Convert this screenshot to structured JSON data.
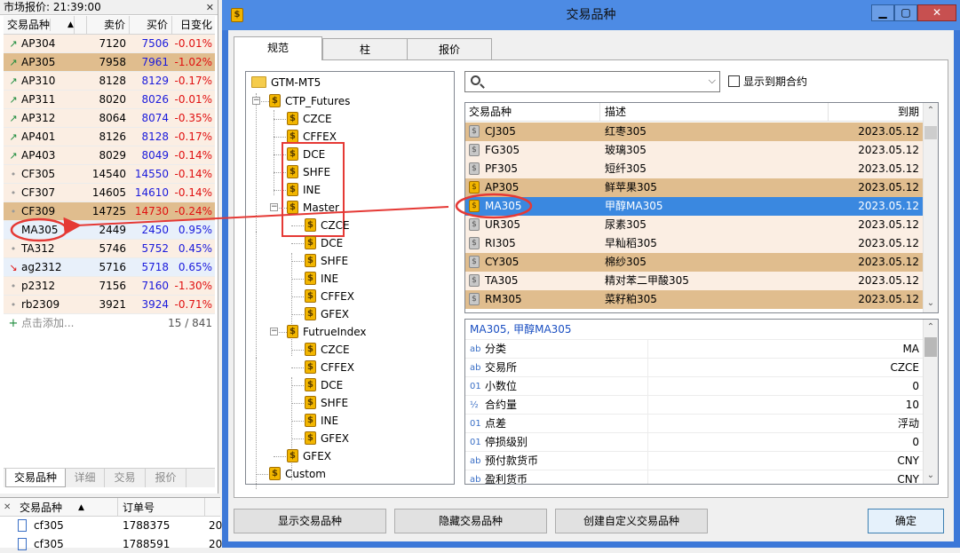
{
  "market": {
    "title": "市场报价: 21:39:00",
    "close": "✕",
    "columns": [
      "交易品种",
      "卖价",
      "买价",
      "日变化"
    ],
    "rows": [
      {
        "icon": "↗",
        "icon_color": "#1b8a3a",
        "symbol": "AP304",
        "bid": "7120",
        "ask": "7506",
        "change": "-0.01%",
        "style": "peach"
      },
      {
        "icon": "↗",
        "icon_color": "#1b8a3a",
        "symbol": "AP305",
        "bid": "7958",
        "ask": "7961",
        "change": "-1.02%",
        "style": "hl"
      },
      {
        "icon": "↗",
        "icon_color": "#1b8a3a",
        "symbol": "AP310",
        "bid": "8128",
        "ask": "8129",
        "change": "-0.17%",
        "style": "peach"
      },
      {
        "icon": "↗",
        "icon_color": "#1b8a3a",
        "symbol": "AP311",
        "bid": "8020",
        "ask": "8026",
        "change": "-0.01%",
        "style": "peach"
      },
      {
        "icon": "↗",
        "icon_color": "#1b8a3a",
        "symbol": "AP312",
        "bid": "8064",
        "ask": "8074",
        "change": "-0.35%",
        "style": "peach"
      },
      {
        "icon": "↗",
        "icon_color": "#1b8a3a",
        "symbol": "AP401",
        "bid": "8126",
        "ask": "8128",
        "change": "-0.17%",
        "style": "peach"
      },
      {
        "icon": "↗",
        "icon_color": "#1b8a3a",
        "symbol": "AP403",
        "bid": "8029",
        "ask": "8049",
        "change": "-0.14%",
        "style": "peach"
      },
      {
        "icon": "•",
        "icon_color": "#999999",
        "symbol": "CF305",
        "bid": "14540",
        "ask": "14550",
        "change": "-0.14%",
        "style": "peach"
      },
      {
        "icon": "•",
        "icon_color": "#999999",
        "symbol": "CF307",
        "bid": "14605",
        "ask": "14610",
        "change": "-0.14%",
        "style": "peach"
      },
      {
        "icon": "•",
        "icon_color": "#999999",
        "symbol": "CF309",
        "bid": "14725",
        "ask": "14730",
        "change": "-0.24%",
        "style": "hl"
      },
      {
        "icon": "",
        "icon_color": "#999999",
        "symbol": "MA305",
        "bid": "2449",
        "ask": "2450",
        "change": "0.95%",
        "style": "hl2"
      },
      {
        "icon": "•",
        "icon_color": "#999999",
        "symbol": "TA312",
        "bid": "5746",
        "ask": "5752",
        "change": "0.45%",
        "style": "peach"
      },
      {
        "icon": "↘",
        "icon_color": "#e01010",
        "symbol": "ag2312",
        "bid": "5716",
        "ask": "5718",
        "change": "0.65%",
        "style": "hl2"
      },
      {
        "icon": "•",
        "icon_color": "#999999",
        "symbol": "p2312",
        "bid": "7156",
        "ask": "7160",
        "change": "-1.30%",
        "style": "peach"
      },
      {
        "icon": "•",
        "icon_color": "#999999",
        "symbol": "rb2309",
        "bid": "3921",
        "ask": "3924",
        "change": "-0.71%",
        "style": "peach"
      }
    ],
    "add_label": "点击添加...",
    "count": "15 / 841",
    "tabs": [
      "交易品种",
      "详细",
      "交易",
      "报价"
    ]
  },
  "trades": {
    "columns": [
      "交易品种",
      "订单号"
    ],
    "rows": [
      {
        "symbol": "cf305",
        "order": "1788375",
        "extra": "20"
      },
      {
        "symbol": "cf305",
        "order": "1788591",
        "extra": "20"
      }
    ]
  },
  "dialog": {
    "title": "交易品种",
    "tabs": [
      "规范",
      "柱",
      "报价"
    ],
    "tree": {
      "root": "GTM-MT5",
      "ctp": "CTP_Futures",
      "ctp_children": [
        "CZCE",
        "CFFEX",
        "DCE",
        "SHFE",
        "INE"
      ],
      "master": "Master",
      "master_children": [
        "CZCE",
        "DCE",
        "SHFE",
        "INE",
        "CFFEX",
        "GFEX"
      ],
      "futrue": "FutrueIndex",
      "futrue_children": [
        "CZCE",
        "CFFEX",
        "DCE",
        "SHFE",
        "INE",
        "GFEX"
      ],
      "gfex": "GFEX",
      "custom": "Custom"
    },
    "search": {
      "value": ""
    },
    "show_expired": "显示到期合约",
    "table": {
      "columns": [
        "交易品种",
        "描述",
        "到期"
      ],
      "rows": [
        {
          "symbol": "CJ305",
          "desc": "红枣305",
          "expiry": "2023.05.12",
          "icon": "grey",
          "style": "tan"
        },
        {
          "symbol": "FG305",
          "desc": "玻璃305",
          "expiry": "2023.05.12",
          "icon": "grey",
          "style": "pale"
        },
        {
          "symbol": "PF305",
          "desc": "短纤305",
          "expiry": "2023.05.12",
          "icon": "grey",
          "style": "pale"
        },
        {
          "symbol": "AP305",
          "desc": "鲜苹果305",
          "expiry": "2023.05.12",
          "icon": "gold",
          "style": "tan"
        },
        {
          "symbol": "MA305",
          "desc": "甲醇MA305",
          "expiry": "2023.05.12",
          "icon": "gold",
          "style": "sel"
        },
        {
          "symbol": "UR305",
          "desc": "尿素305",
          "expiry": "2023.05.12",
          "icon": "grey",
          "style": "pale"
        },
        {
          "symbol": "RI305",
          "desc": "早籼稻305",
          "expiry": "2023.05.12",
          "icon": "grey",
          "style": "pale"
        },
        {
          "symbol": "CY305",
          "desc": "棉纱305",
          "expiry": "2023.05.12",
          "icon": "grey",
          "style": "tan"
        },
        {
          "symbol": "TA305",
          "desc": "精对苯二甲酸305",
          "expiry": "2023.05.12",
          "icon": "grey",
          "style": "pale"
        },
        {
          "symbol": "RM305",
          "desc": "菜籽粕305",
          "expiry": "2023.05.12",
          "icon": "grey",
          "style": "tan"
        }
      ]
    },
    "props": {
      "title": "MA305, 甲醇MA305",
      "rows": [
        {
          "icon": "ab",
          "key": "分类",
          "value": "MA"
        },
        {
          "icon": "ab",
          "key": "交易所",
          "value": "CZCE"
        },
        {
          "icon": "01",
          "key": "小数位",
          "value": "0"
        },
        {
          "icon": "½",
          "key": "合约量",
          "value": "10"
        },
        {
          "icon": "01",
          "key": "点差",
          "value": "浮动"
        },
        {
          "icon": "01",
          "key": "停损级别",
          "value": "0"
        },
        {
          "icon": "ab",
          "key": "预付款货币",
          "value": "CNY"
        },
        {
          "icon": "ab",
          "key": "盈利货币",
          "value": "CNY"
        }
      ]
    },
    "buttons": {
      "show": "显示交易品种",
      "hide": "隐藏交易品种",
      "create": "创建自定义交易品种",
      "ok": "确定"
    }
  },
  "colors": {
    "title_bar": "#4d8be4",
    "selection": "#3a88e0",
    "highlight": "#e0bd8e",
    "annotation": "#e53935"
  }
}
